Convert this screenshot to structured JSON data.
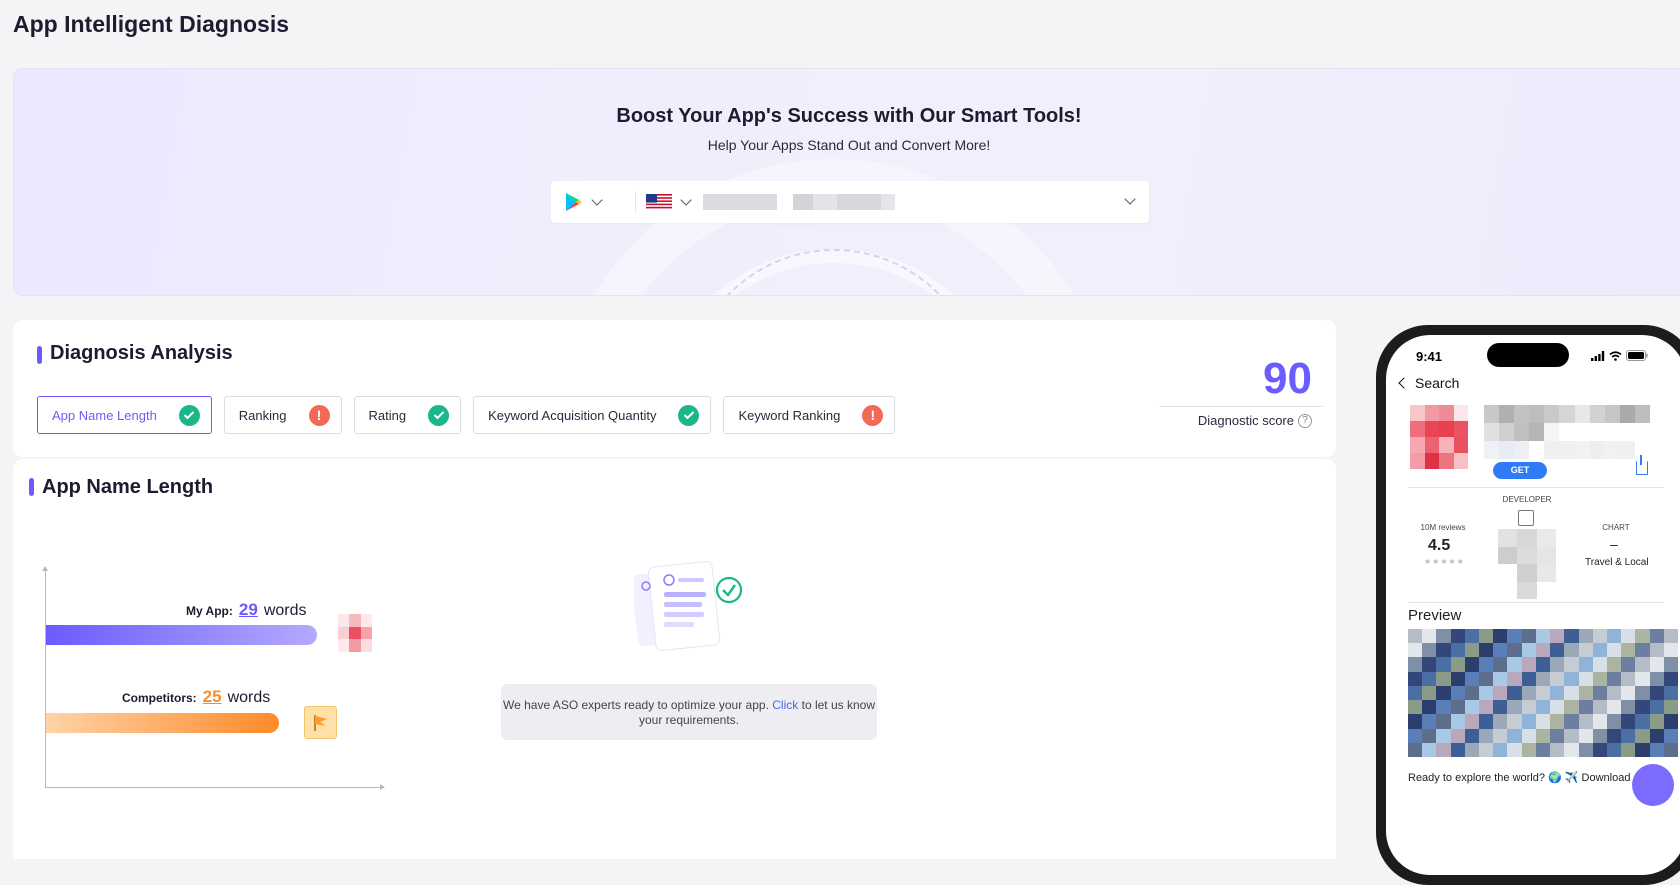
{
  "page": {
    "title": "App Intelligent Diagnosis"
  },
  "hero": {
    "title": "Boost Your App's Success with Our Smart Tools!",
    "subtitle": "Help Your Apps Stand Out and Convert More!",
    "store_icon": "google-play-icon",
    "country_icon": "us-flag-icon"
  },
  "diagnosis": {
    "title": "Diagnosis Analysis",
    "tabs": [
      {
        "label": "App Name Length",
        "status": "ok",
        "active": true
      },
      {
        "label": "Ranking",
        "status": "warn",
        "active": false
      },
      {
        "label": "Rating",
        "status": "ok",
        "active": false
      },
      {
        "label": "Keyword Acquisition Quantity",
        "status": "ok",
        "active": false
      },
      {
        "label": "Keyword Ranking",
        "status": "warn",
        "active": false
      }
    ],
    "score": "90",
    "score_label": "Diagnostic score",
    "help_symbol": "?"
  },
  "app_name_length": {
    "title": "App Name Length",
    "my_app": {
      "label": "My App:",
      "value": "29",
      "unit": "words"
    },
    "competitors": {
      "label": "Competitors:",
      "value": "25",
      "unit": "words"
    },
    "aso_text": "We have ASO experts ready to optimize your app.",
    "aso_link": "Click",
    "aso_text_after": "to let us know your requirements."
  },
  "phone": {
    "time": "9:41",
    "back_label": "Search",
    "get_label": "GET",
    "reviews_label": "10M reviews",
    "rating": "4.5",
    "stars": "★★★★★",
    "developer_label": "DEVELOPER",
    "chart_label": "CHART",
    "chart_value": "–",
    "chart_category": "Travel & Local",
    "preview_label": "Preview",
    "bottom_text": "Ready to explore the world? 🌍 ✈️ Download"
  },
  "colors": {
    "accent": "#6a5cff",
    "ok": "#1bb68a",
    "warn": "#f26a55",
    "competitor": "#ff8a2a"
  }
}
